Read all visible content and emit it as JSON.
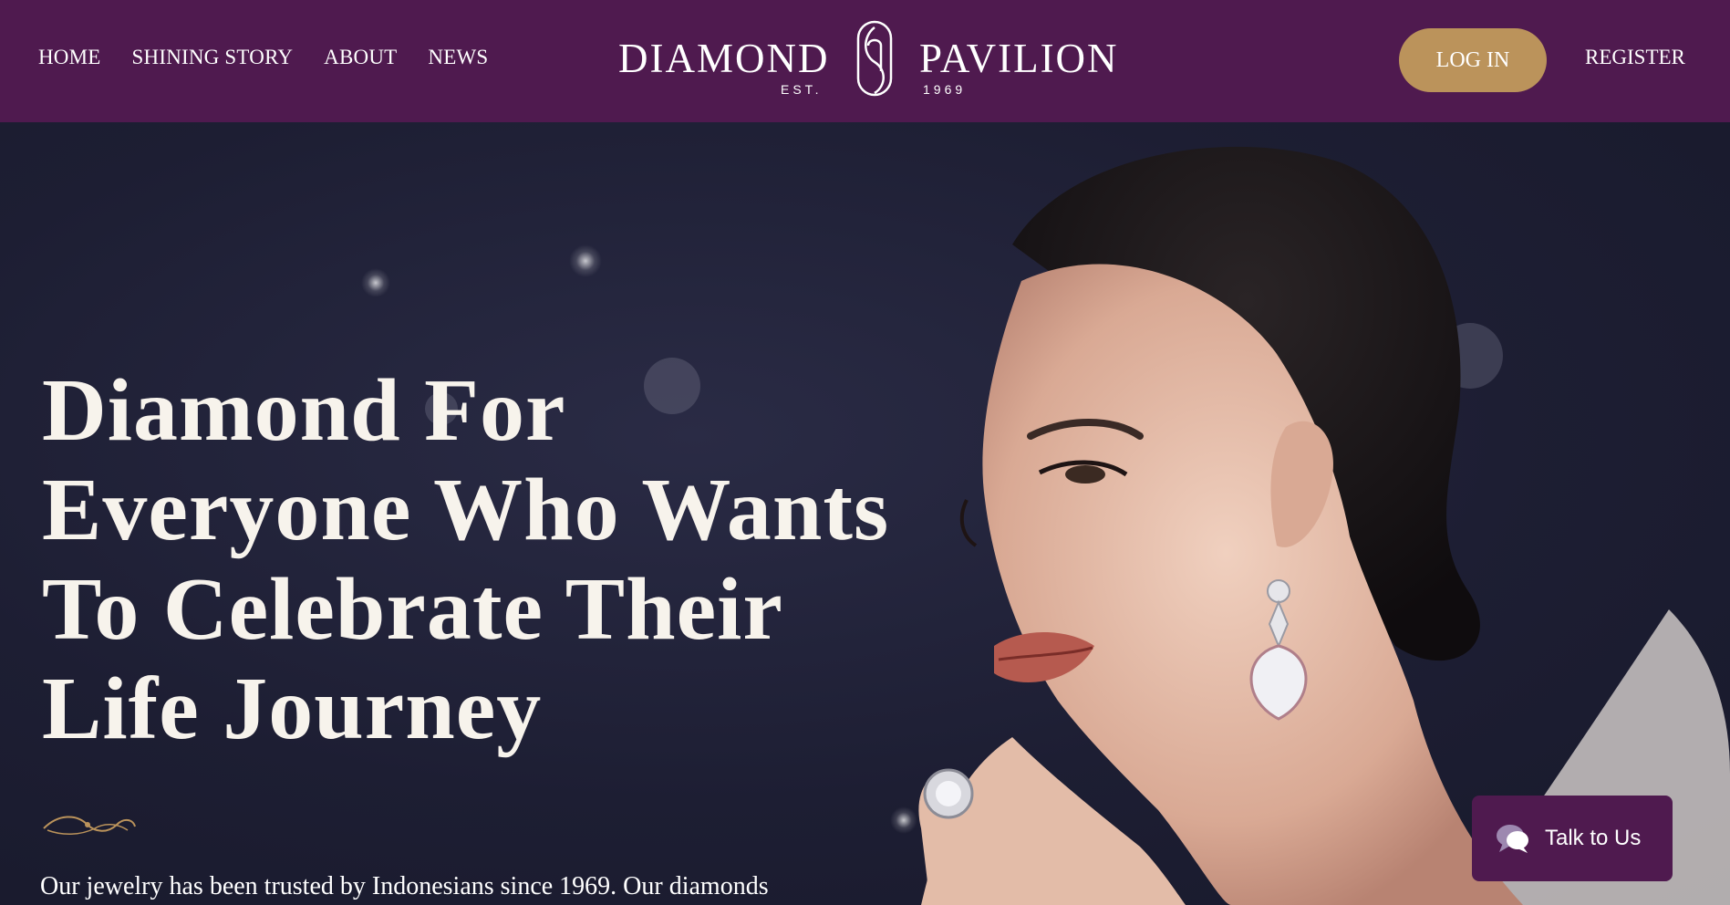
{
  "nav": {
    "links": [
      {
        "label": "HOME"
      },
      {
        "label": "SHINING STORY"
      },
      {
        "label": "ABOUT"
      },
      {
        "label": "NEWS"
      }
    ],
    "login_label": "LOG IN",
    "register_label": "REGISTER"
  },
  "logo": {
    "word_left": "DIAMOND",
    "word_right": "PAVILION",
    "est": "EST.",
    "year": "1969"
  },
  "hero": {
    "title": "Diamond For Everyone Who Wants To Celebrate Their Life Journey",
    "description": "Our jewelry has been trusted by Indonesians since 1969. Our diamonds"
  },
  "chat": {
    "label": "Talk to Us",
    "icon": "chat-bubbles-icon"
  },
  "colors": {
    "brand_purple": "#4f1a4f",
    "gold_accent": "#bb935b",
    "hero_background": "#1f2035"
  }
}
